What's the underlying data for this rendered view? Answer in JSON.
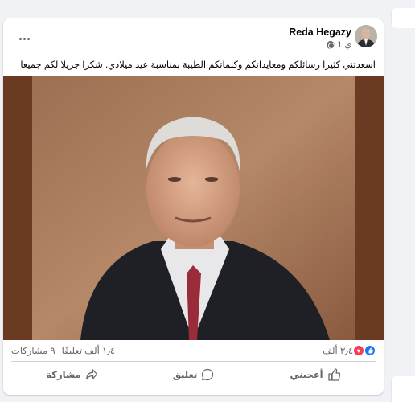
{
  "post": {
    "author_name": "Reda Hegazy",
    "time": "1 ي",
    "text": "اسعدتني كثيرا رسائلكم ومعايداتكم وكلماتكم الطيبة بمناسبة عيد ميلادي. شكرا جزيلا لكم جميعا",
    "reaction_count": "٣٫٤ ألف",
    "comment_count": "١٫٤ ألف تعليقًا",
    "share_count": "٩ مشاركات",
    "actions": {
      "like": "أعجبني",
      "comment": "تعليق",
      "share": "مشاركة"
    }
  },
  "icons": {
    "like_reaction": "thumbs-up-icon",
    "love_reaction": "heart-icon",
    "globe": "globe-icon",
    "more": "more-icon"
  },
  "colors": {
    "like_blue": "#1877f2",
    "love_red": "#f33e58",
    "photo_background": "#6b3a22"
  }
}
